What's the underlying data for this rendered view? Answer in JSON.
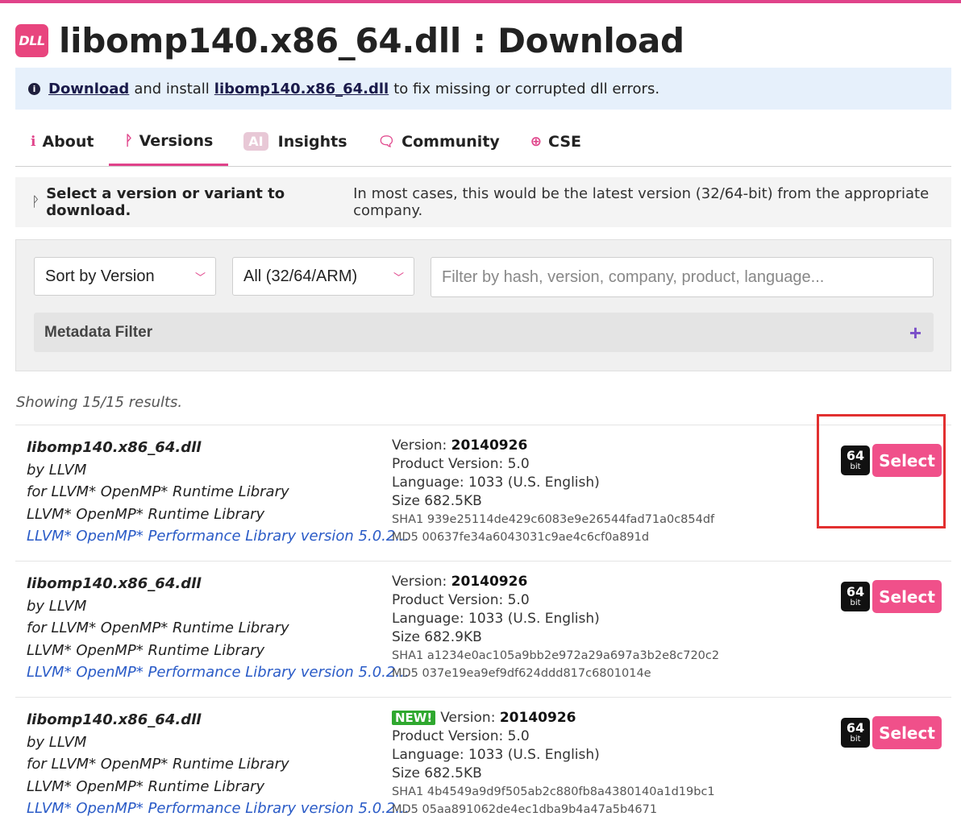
{
  "page": {
    "logo_text": "DLL",
    "title": "libomp140.x86_64.dll : Download"
  },
  "banner": {
    "link1": "Download",
    "text1": "and install",
    "link2": "libomp140.x86_64.dll",
    "text2": "to fix missing or corrupted dll errors."
  },
  "tabs": [
    {
      "label": "About",
      "icon": "info-icon"
    },
    {
      "label": "Versions",
      "icon": "branch-icon",
      "active": true
    },
    {
      "label": "Insights",
      "icon": "ai-badge",
      "badge": "AI"
    },
    {
      "label": "Community",
      "icon": "chat-icon"
    },
    {
      "label": "CSE",
      "icon": "magnifier-icon"
    }
  ],
  "prompt": {
    "bold": "Select a version or variant to download.",
    "text": "In most cases, this would be the latest version (32/64-bit) from the appropriate company."
  },
  "filters": {
    "sort_value": "Sort by Version",
    "arch_value": "All (32/64/ARM)",
    "search_placeholder": "Filter by hash, version, company, product, language...",
    "metadata_label": "Metadata Filter",
    "metadata_toggle": "+"
  },
  "results_summary": "Showing 15/15 results.",
  "results": [
    {
      "filename": "libomp140.x86_64.dll",
      "by": "by LLVM",
      "for": "for LLVM* OpenMP* Runtime Library",
      "product": "LLVM* OpenMP* Runtime Library",
      "description": "LLVM* OpenMP* Performance Library version 5.0.2...",
      "new_badge": "",
      "version_label": "Version:",
      "version": "20140926",
      "product_version": "Product Version: 5.0",
      "language": "Language: 1033 (U.S. English)",
      "size": "Size 682.5KB",
      "sha1": "SHA1 939e25114de429c6083e9e26544fad71a0c854df",
      "md5": "MD5 00637fe34a6043031c9ae4c6cf0a891d",
      "bits": "64",
      "bits_label": "bit",
      "select_label": "Select"
    },
    {
      "filename": "libomp140.x86_64.dll",
      "by": "by LLVM",
      "for": "for LLVM* OpenMP* Runtime Library",
      "product": "LLVM* OpenMP* Runtime Library",
      "description": "LLVM* OpenMP* Performance Library version 5.0.2...",
      "new_badge": "",
      "version_label": "Version:",
      "version": "20140926",
      "product_version": "Product Version: 5.0",
      "language": "Language: 1033 (U.S. English)",
      "size": "Size 682.9KB",
      "sha1": "SHA1 a1234e0ac105a9bb2e972a29a697a3b2e8c720c2",
      "md5": "MD5 037e19ea9ef9df624ddd817c6801014e",
      "bits": "64",
      "bits_label": "bit",
      "select_label": "Select"
    },
    {
      "filename": "libomp140.x86_64.dll",
      "by": "by LLVM",
      "for": "for LLVM* OpenMP* Runtime Library",
      "product": "LLVM* OpenMP* Runtime Library",
      "description": "LLVM* OpenMP* Performance Library version 5.0.2...",
      "new_badge": "NEW!",
      "version_label": "Version:",
      "version": "20140926",
      "product_version": "Product Version: 5.0",
      "language": "Language: 1033 (U.S. English)",
      "size": "Size 682.5KB",
      "sha1": "SHA1 4b4549a9d9f505ab2c880fb8a4380140a1d19bc1",
      "md5": "MD5 05aa891062de4ec1dba9b4a47a5b4671",
      "bits": "64",
      "bits_label": "bit",
      "select_label": "Select"
    }
  ],
  "colors": {
    "accent": "#e0438a",
    "select_button": "#f0508a",
    "banner_bg": "#e6f0fb",
    "link": "#2a5bc7",
    "new_badge": "#2fa82f",
    "highlight": "#e23030"
  }
}
